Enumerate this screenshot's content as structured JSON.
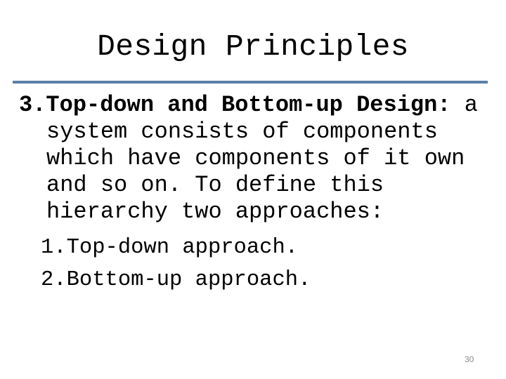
{
  "slide": {
    "title": "Design Principles",
    "accent_color": "#5b7fa6",
    "point": {
      "number": "3.",
      "heading": "Top-down and Bottom-up Design:",
      "text_first_line": " a",
      "text_lines": [
        "system consists of components",
        "which have components of it own",
        "and so on. To define this",
        "hierarchy two approaches:"
      ]
    },
    "sublist": [
      {
        "number": "1.",
        "label": "Top-down approach."
      },
      {
        "number": "2.",
        "label": "Bottom-up approach."
      }
    ],
    "slide_number": "30"
  }
}
